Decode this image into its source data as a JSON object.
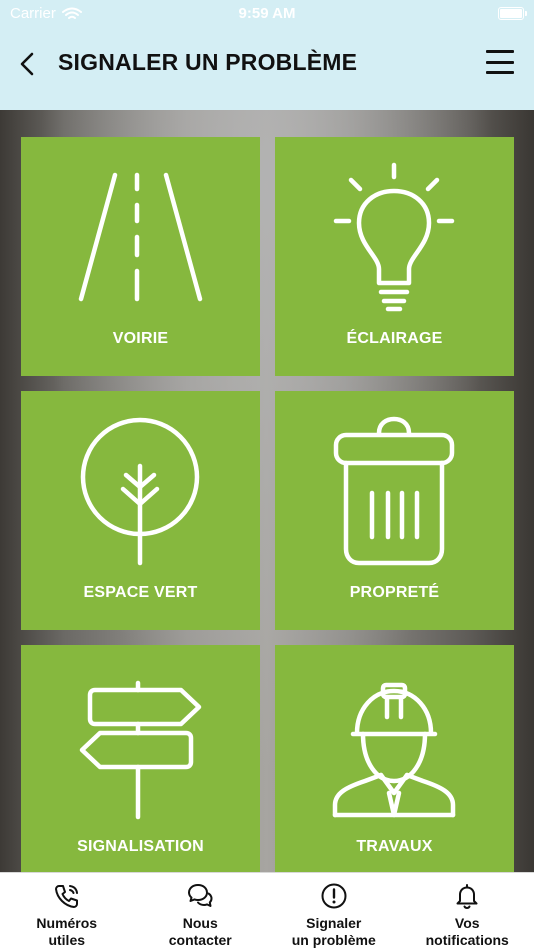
{
  "status_bar": {
    "carrier": "Carrier",
    "time": "9:59 AM",
    "wifi_icon": "wifi-icon",
    "battery_icon": "battery-icon"
  },
  "header": {
    "back_icon": "chevron-left-icon",
    "title": "SIGNALER UN PROBLÈME",
    "menu_icon": "hamburger-menu-icon",
    "background": "#d4eef4"
  },
  "tiles": [
    {
      "label": "VOIRIE",
      "icon": "road-icon"
    },
    {
      "label": "ÉCLAIRAGE",
      "icon": "lightbulb-icon"
    },
    {
      "label": "ESPACE VERT",
      "icon": "tree-icon"
    },
    {
      "label": "PROPRETÉ",
      "icon": "trash-bin-icon"
    },
    {
      "label": "SIGNALISATION",
      "icon": "signpost-icon"
    },
    {
      "label": "TRAVAUX",
      "icon": "construction-worker-icon"
    }
  ],
  "tile_color": "#86b83e",
  "tab_bar": {
    "items": [
      {
        "label": "Numéros\nutiles",
        "icon": "phone-call-icon"
      },
      {
        "label": "Nous\ncontacter",
        "icon": "chat-bubbles-icon"
      },
      {
        "label": "Signaler\nun problème",
        "icon": "alert-circle-icon"
      },
      {
        "label": "Vos\nnotifications",
        "icon": "bell-icon"
      }
    ]
  }
}
